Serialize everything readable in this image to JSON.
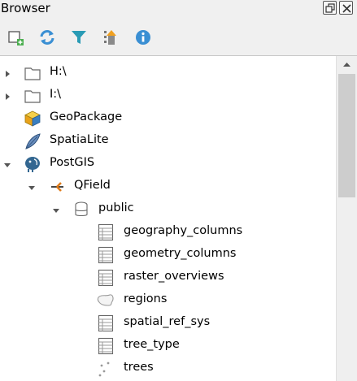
{
  "window": {
    "title": "Browser"
  },
  "title_buttons": [
    {
      "name": "float-panel-button",
      "icon": "float-icon"
    },
    {
      "name": "close-panel-button",
      "icon": "close-icon"
    }
  ],
  "toolbar": [
    {
      "name": "add-selected-layers-button",
      "icon": "add-layer-icon"
    },
    {
      "name": "refresh-button",
      "icon": "refresh-icon"
    },
    {
      "name": "filter-button",
      "icon": "filter-icon"
    },
    {
      "name": "collapse-all-button",
      "icon": "collapse-icon"
    },
    {
      "name": "properties-button",
      "icon": "info-icon"
    }
  ],
  "tree": [
    {
      "label": "H:\\",
      "icon": "folder-icon",
      "arrow": "collapsed"
    },
    {
      "label": "I:\\",
      "icon": "folder-icon",
      "arrow": "collapsed"
    },
    {
      "label": "GeoPackage",
      "icon": "geopackage-icon",
      "arrow": "none"
    },
    {
      "label": "SpatiaLite",
      "icon": "spatialite-icon",
      "arrow": "none"
    },
    {
      "label": "PostGIS",
      "icon": "postgis-icon",
      "arrow": "expanded"
    },
    {
      "label": "QField",
      "icon": "connection-icon",
      "arrow": "expanded"
    },
    {
      "label": "public",
      "icon": "schema-icon",
      "arrow": "expanded"
    },
    {
      "label": "geography_columns",
      "icon": "table-icon",
      "arrow": "none"
    },
    {
      "label": "geometry_columns",
      "icon": "table-icon",
      "arrow": "none"
    },
    {
      "label": "raster_overviews",
      "icon": "table-icon",
      "arrow": "none"
    },
    {
      "label": "regions",
      "icon": "polygon-layer-icon",
      "arrow": "none"
    },
    {
      "label": "spatial_ref_sys",
      "icon": "table-icon",
      "arrow": "none"
    },
    {
      "label": "tree_type",
      "icon": "table-icon",
      "arrow": "none"
    },
    {
      "label": "trees",
      "icon": "point-layer-icon",
      "arrow": "none"
    }
  ],
  "colors": {
    "accent_blue": "#3a8fd3",
    "filter_teal": "#2a9bb5",
    "geopackage_yellow": "#f4c430",
    "postgis_blue": "#336791",
    "connection_orange": "#e07b1a"
  }
}
